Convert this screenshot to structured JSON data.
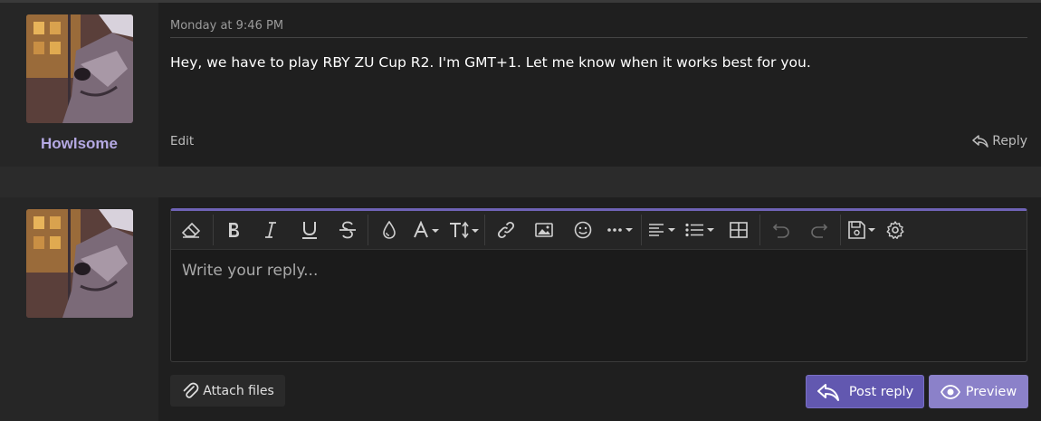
{
  "message": {
    "date": "Monday at 9:46 PM",
    "body": "Hey, we have to play RBY ZU Cup R2. I'm GMT+1. Let me know when it works best for you.",
    "username": "Howlsome",
    "edit_label": "Edit",
    "reply_label": "Reply"
  },
  "editor": {
    "placeholder": "Write your reply...",
    "toolbar_icons": [
      "eraser-icon",
      "bold-icon",
      "italic-icon",
      "underline-icon",
      "strikethrough-icon",
      "color-drop-icon",
      "font-family-icon",
      "font-size-icon",
      "link-icon",
      "image-icon",
      "smiley-icon",
      "more-icon",
      "align-icon",
      "list-icon",
      "table-icon",
      "undo-icon",
      "redo-icon",
      "save-drafts-icon",
      "settings-icon"
    ]
  },
  "actions": {
    "attach_label": "Attach files",
    "post_label": "Post reply",
    "preview_label": "Preview"
  },
  "colors": {
    "accent": "#6258b0",
    "accent_light": "#8b81c9",
    "username": "#b5a9e3",
    "editor_border_top": "#6f63b6"
  }
}
